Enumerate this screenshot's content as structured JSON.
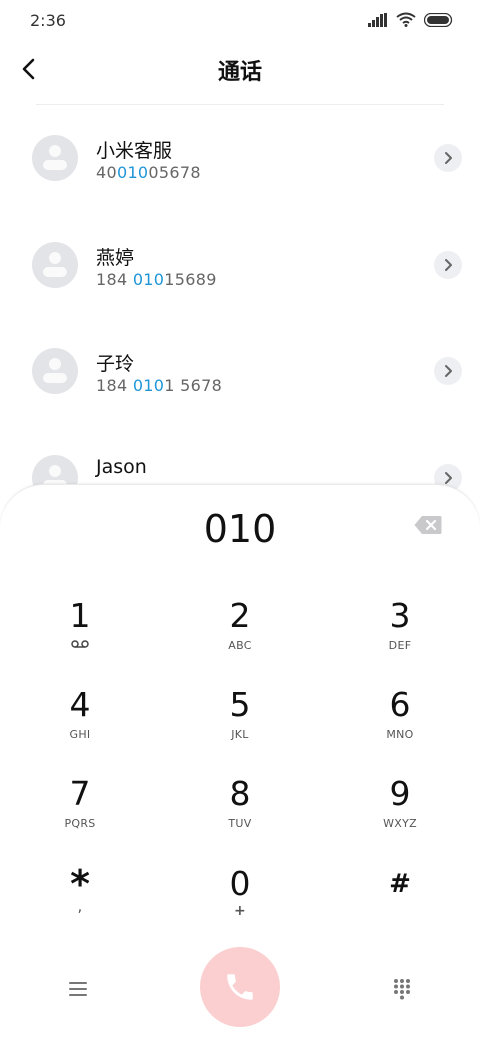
{
  "status_bar": {
    "time": "2:36"
  },
  "header": {
    "title": "通话"
  },
  "contacts": [
    {
      "name": "小米客服",
      "number_pre": "40",
      "number_match": "010",
      "number_post": "05678"
    },
    {
      "name": "燕婷",
      "number_pre": "184 ",
      "number_match": "010",
      "number_post": "15689"
    },
    {
      "name": "子玲",
      "number_pre": "184 ",
      "number_match": "010",
      "number_post": "1 5678"
    },
    {
      "name": "Jason",
      "number_pre": "",
      "number_match": "",
      "number_post": ""
    }
  ],
  "dialer": {
    "input": "010",
    "keys": [
      {
        "digit": "1",
        "sub": ""
      },
      {
        "digit": "2",
        "sub": "ABC"
      },
      {
        "digit": "3",
        "sub": "DEF"
      },
      {
        "digit": "4",
        "sub": "GHI"
      },
      {
        "digit": "5",
        "sub": "JKL"
      },
      {
        "digit": "6",
        "sub": "MNO"
      },
      {
        "digit": "7",
        "sub": "PQRS"
      },
      {
        "digit": "8",
        "sub": "TUV"
      },
      {
        "digit": "9",
        "sub": "WXYZ"
      },
      {
        "digit": "*",
        "sub": ","
      },
      {
        "digit": "0",
        "sub": "+"
      },
      {
        "digit": "#",
        "sub": ""
      }
    ]
  },
  "icons": {
    "back": "back-arrow-icon",
    "backspace": "backspace-icon",
    "voicemail": "voicemail-icon",
    "menu": "menu-icon",
    "call": "phone-icon",
    "keypad": "keypad-grid-icon"
  },
  "colors": {
    "match_highlight": "#1e96d8",
    "call_button": "#fbcfd0",
    "avatar_bg": "#e3e4e8"
  }
}
